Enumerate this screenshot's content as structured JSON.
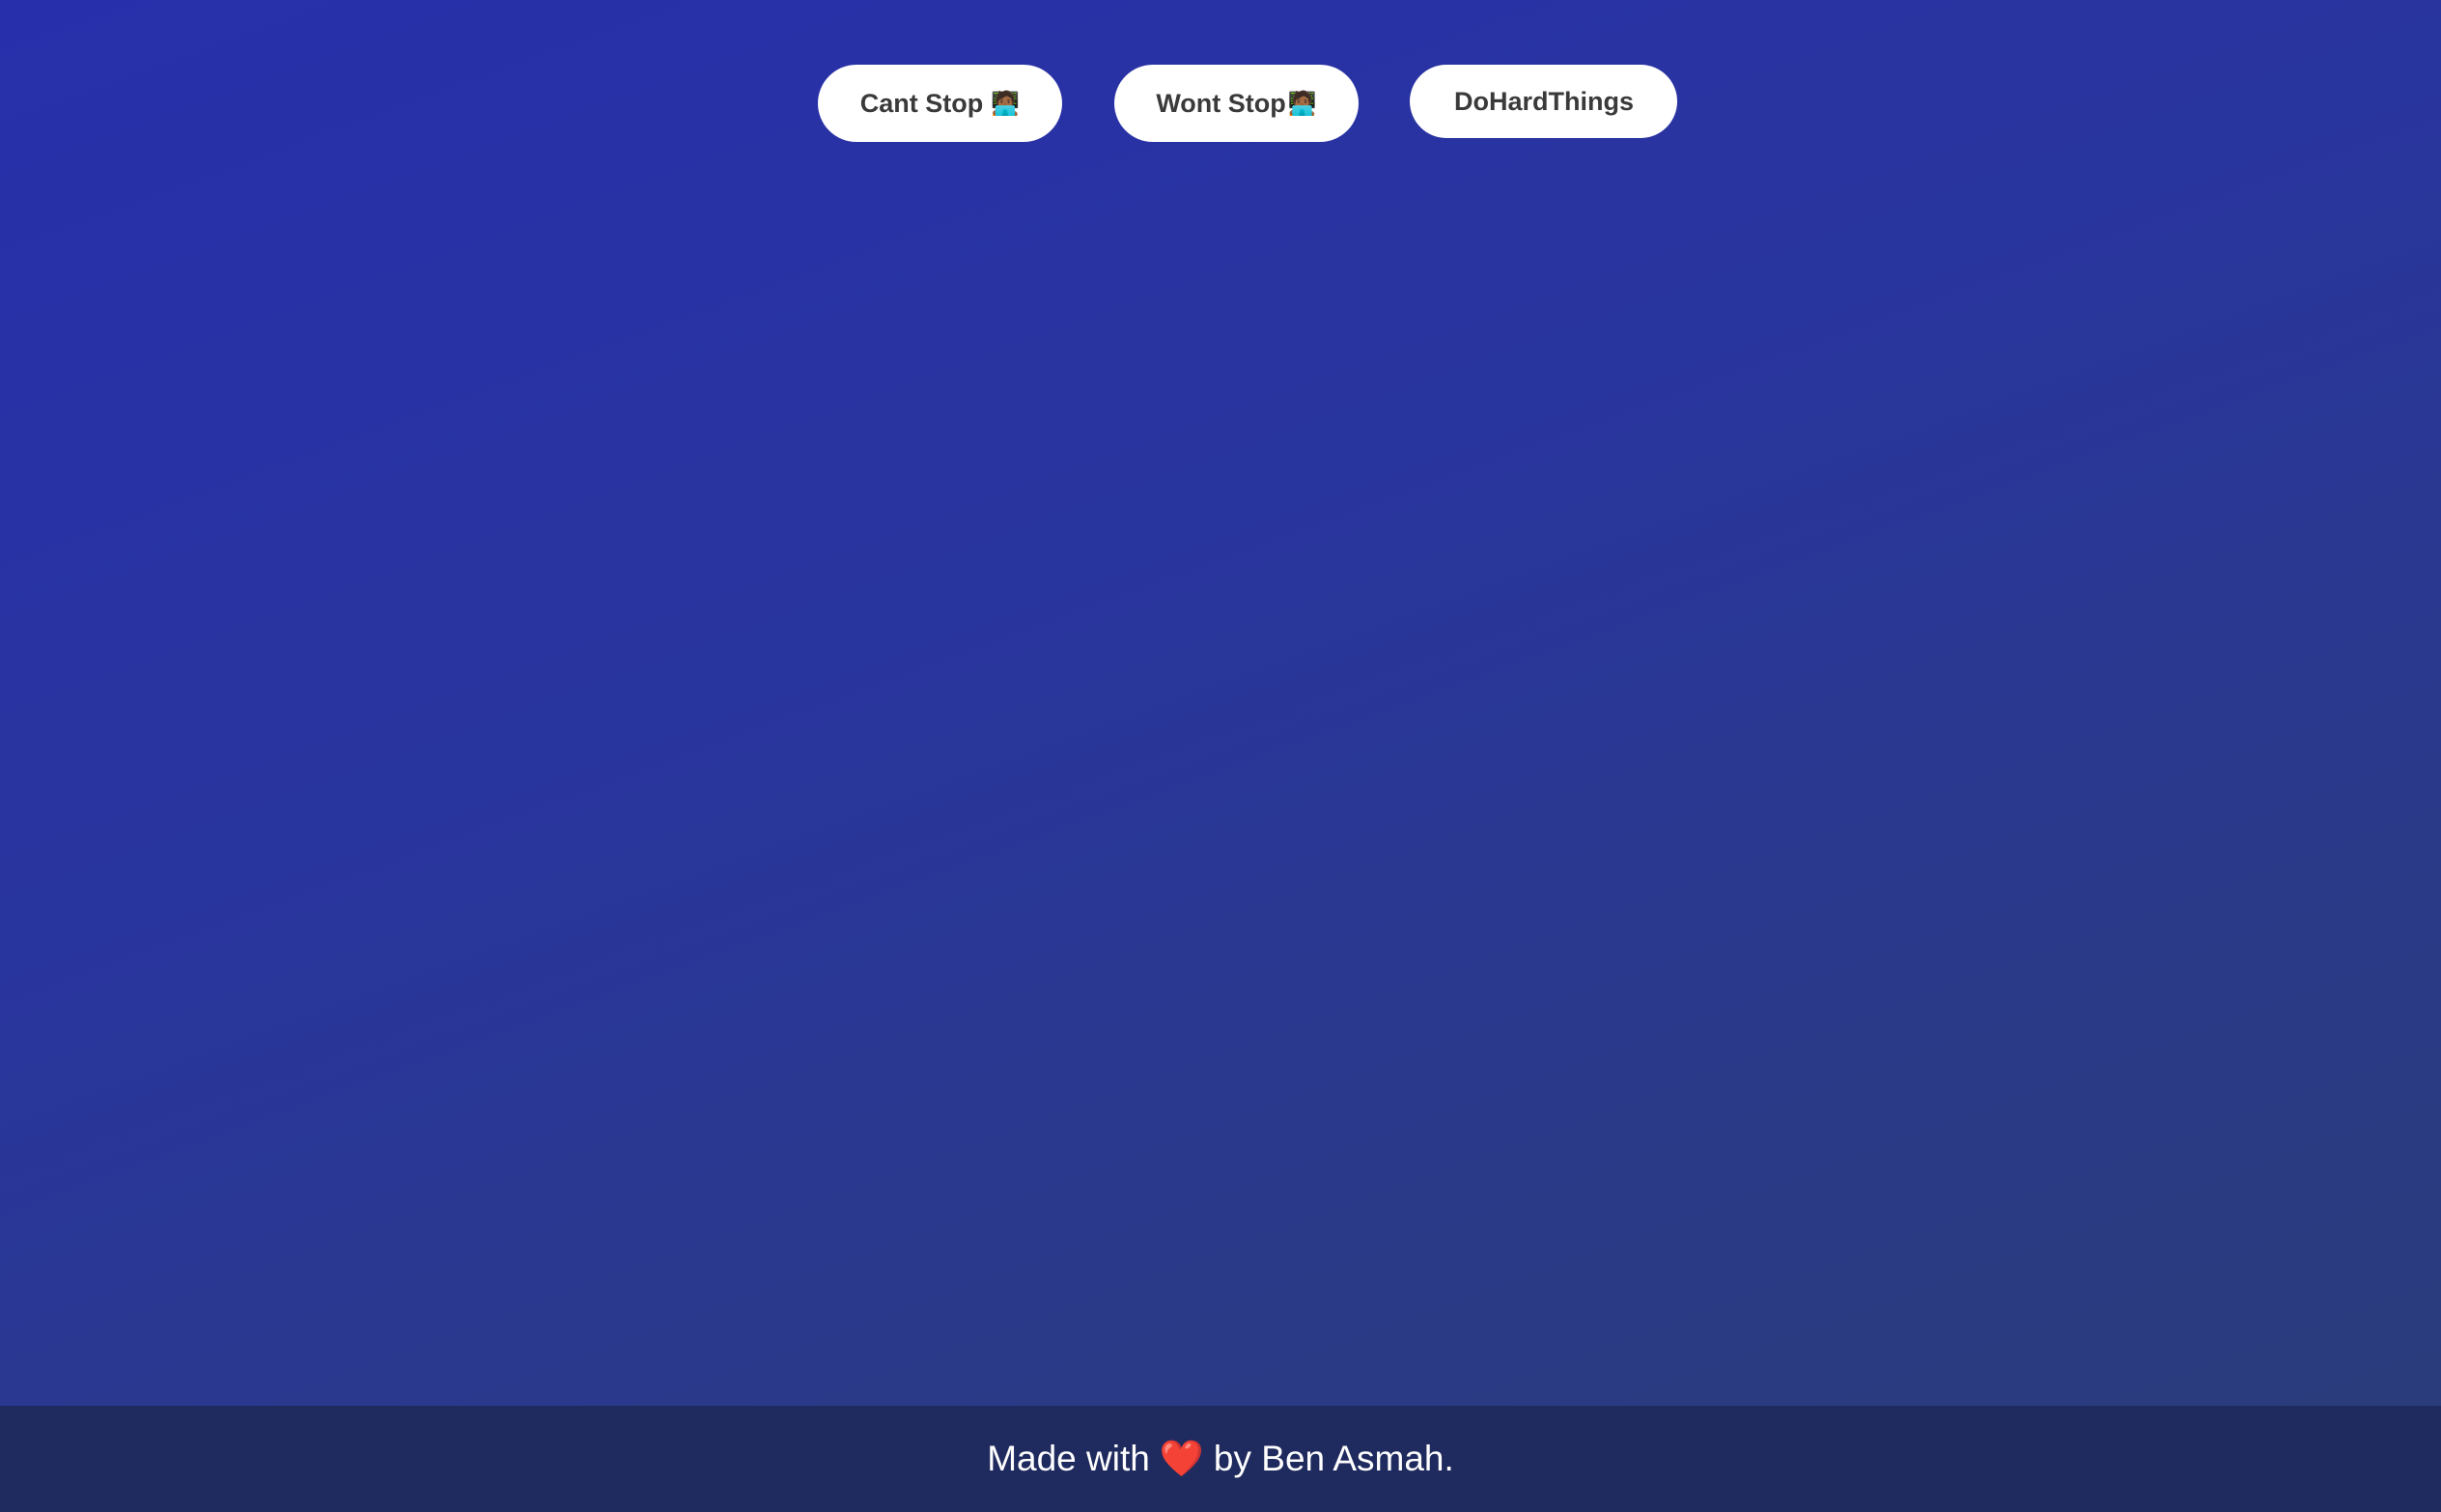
{
  "buttons": {
    "cant_stop": {
      "label": "Cant Stop",
      "emoji": "🧑🏾‍💻"
    },
    "wont_stop": {
      "label": "Wont Stop",
      "emoji": "🧑🏾‍💻"
    }
  },
  "input": {
    "value": "DoHardThings"
  },
  "footer": {
    "prefix": "Made with",
    "heart": "❤️",
    "suffix": "by Ben Asmah."
  },
  "colors": {
    "background_start": "#282fab",
    "background_end": "#2b3c7a",
    "footer_bg": "#1f2a5e",
    "pill_bg": "#ffffff",
    "pill_text": "#3a3a3a",
    "heart": "#e8232f"
  }
}
